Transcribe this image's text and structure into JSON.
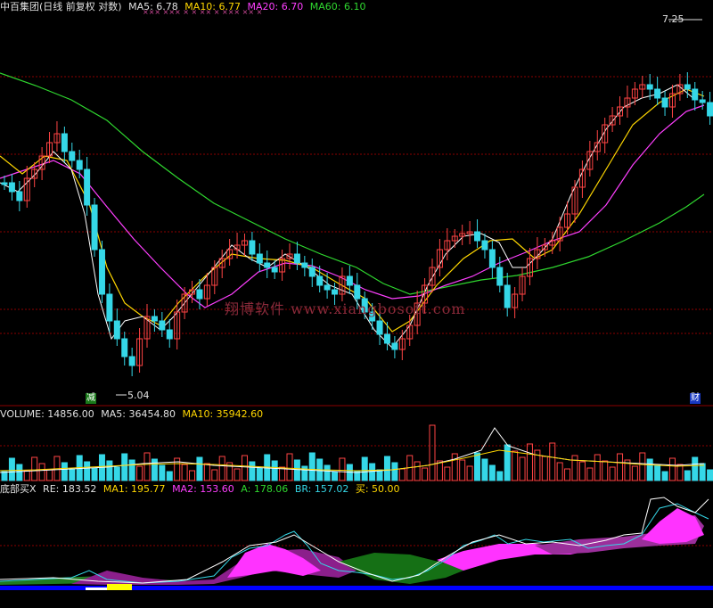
{
  "main_panel": {
    "stock_name": "中百集团(日线 前复权 对数)",
    "ma5": "MA5: 6.78",
    "ma10": "MA10: 6.77",
    "ma20": "MA20: 6.70",
    "ma60": "MA60: 6.10",
    "high_price": "7.25",
    "low_price": "5.04",
    "tag_jian": "减",
    "tag_cai": "财",
    "watermark": "翔博软件 www.xiangbosoft.com",
    "event_marks": "×××  ×××  ×  ×  ××  ×  ×××  ××  ×"
  },
  "volume_panel": {
    "volume": "VOLUME: 14856.00",
    "ma5": "MA5: 36454.80",
    "ma10": "MA10: 35942.60"
  },
  "indicator_panel": {
    "name": "底部买X",
    "re": "RE: 183.52",
    "ma1": "MA1: 195.77",
    "ma2": "MA2: 153.60",
    "a": "A: 178.06",
    "br": "BR: 157.02",
    "buy": "买: 50.00"
  },
  "colors": {
    "up": "#ff4444",
    "down": "#35d7e7",
    "ma5": "#ffffff",
    "ma10": "#ffd700",
    "ma20": "#ff3fff",
    "ma60": "#2fd82f",
    "grid": "#8b0000"
  }
}
